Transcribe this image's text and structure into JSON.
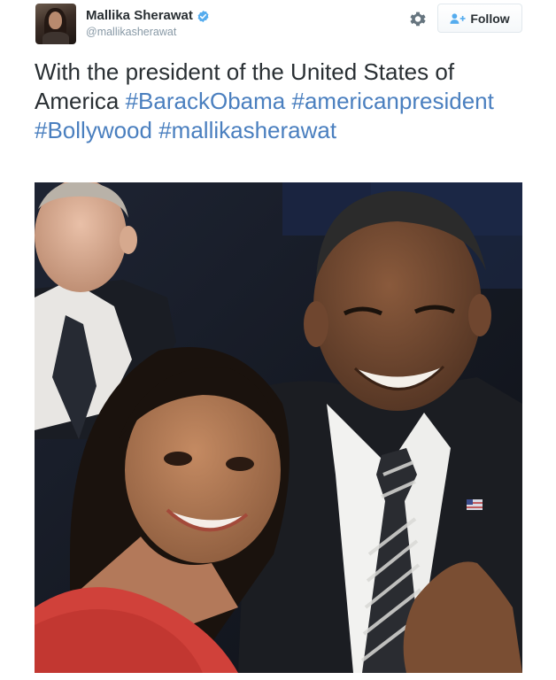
{
  "user": {
    "display_name": "Mallika Sherawat",
    "handle": "@mallikasherawat"
  },
  "actions": {
    "follow_label": "Follow"
  },
  "tweet": {
    "text_plain": "With the president of the United States of America",
    "hashtags": [
      "#BarackObama",
      "#americanpresident",
      "#Bollywood",
      "#mallikasherawat"
    ]
  },
  "icons": {
    "verified": "verified-badge-icon",
    "settings": "gear-icon",
    "follow": "add-user-icon"
  },
  "colors": {
    "hashtag": "#4a7fbf",
    "verified": "#55acee",
    "handle": "#8899a6"
  }
}
